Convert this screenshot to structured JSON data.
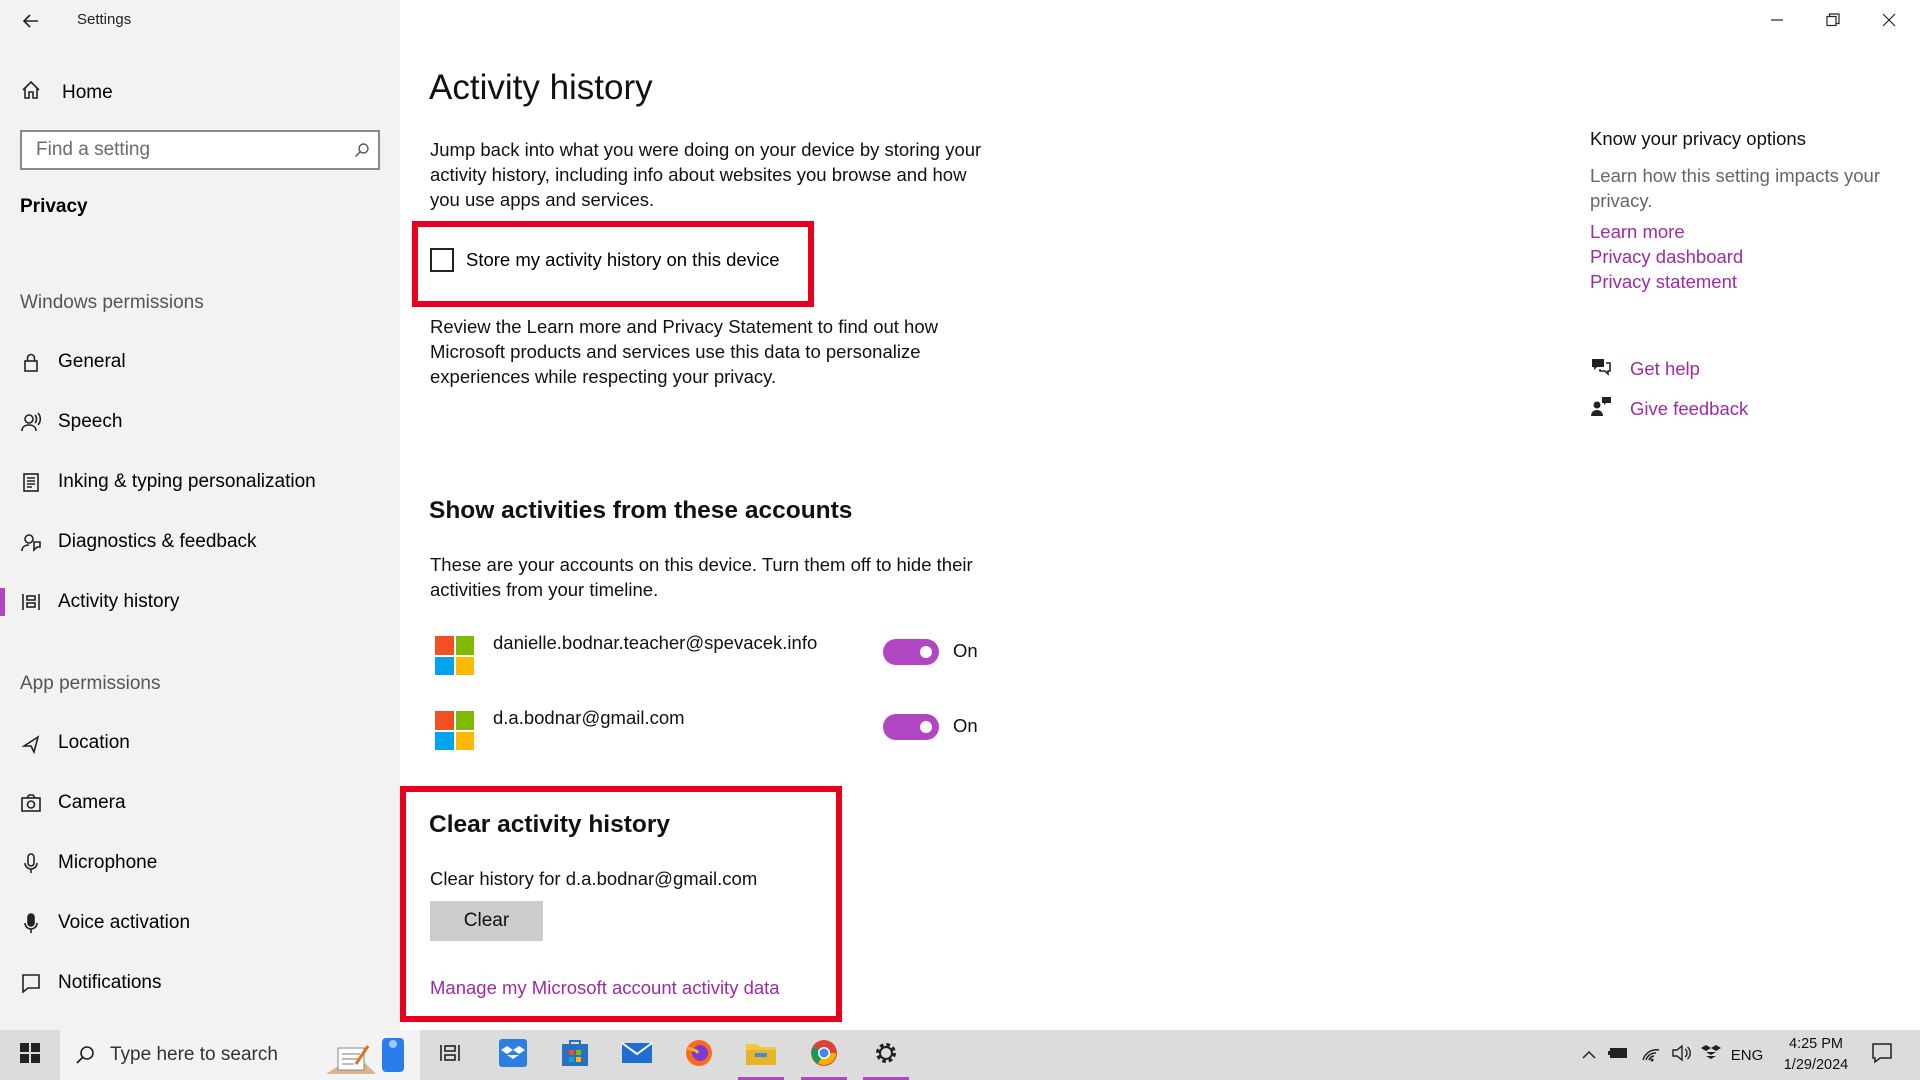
{
  "window": {
    "title": "Settings",
    "controls": {
      "minimize": "─",
      "restore": "❐",
      "close": "✕"
    }
  },
  "sidebar": {
    "home": "Home",
    "search_placeholder": "Find a setting",
    "section": "Privacy",
    "windows_permissions_label": "Windows permissions",
    "windows_permissions": [
      {
        "label": "General",
        "icon": "lock-icon"
      },
      {
        "label": "Speech",
        "icon": "speech-icon"
      },
      {
        "label": "Inking & typing personalization",
        "icon": "inking-icon"
      },
      {
        "label": "Diagnostics & feedback",
        "icon": "diagnostics-icon"
      },
      {
        "label": "Activity history",
        "icon": "timeline-icon",
        "active": true
      }
    ],
    "app_permissions_label": "App permissions",
    "app_permissions": [
      {
        "label": "Location",
        "icon": "location-icon"
      },
      {
        "label": "Camera",
        "icon": "camera-icon"
      },
      {
        "label": "Microphone",
        "icon": "microphone-icon"
      },
      {
        "label": "Voice activation",
        "icon": "voice-activation-icon"
      },
      {
        "label": "Notifications",
        "icon": "notifications-icon"
      }
    ]
  },
  "main": {
    "title": "Activity history",
    "intro": "Jump back into what you were doing on your device by storing your activity history, including info about websites you browse and how you use apps and services.",
    "store_checkbox": {
      "label": "Store my activity history on this device",
      "checked": false
    },
    "review_text": "Review the Learn more and Privacy Statement to find out how Microsoft products and services use this data to personalize experiences while respecting your privacy.",
    "accounts_heading": "Show activities from these accounts",
    "accounts_text": "These are your accounts on this device. Turn them off to hide their activities from your timeline.",
    "accounts": [
      {
        "email": "danielle.bodnar.teacher@spevacek.info",
        "state": "On"
      },
      {
        "email": "d.a.bodnar@gmail.com",
        "state": "On"
      }
    ],
    "clear_heading": "Clear activity history",
    "clear_for": "Clear history for d.a.bodnar@gmail.com",
    "clear_button": "Clear",
    "manage_link": "Manage my Microsoft account activity data"
  },
  "right": {
    "title": "Know your privacy options",
    "text": "Learn how this setting impacts your privacy.",
    "links": [
      "Learn more",
      "Privacy dashboard",
      "Privacy statement"
    ],
    "get_help": "Get help",
    "give_feedback": "Give feedback"
  },
  "taskbar": {
    "search_placeholder": "Type here to search",
    "language": "ENG",
    "time": "4:25 PM",
    "date": "1/29/2024"
  },
  "colors": {
    "accent": "#b146c2",
    "link": "#9e2aa9",
    "highlight": "#e8001c"
  }
}
